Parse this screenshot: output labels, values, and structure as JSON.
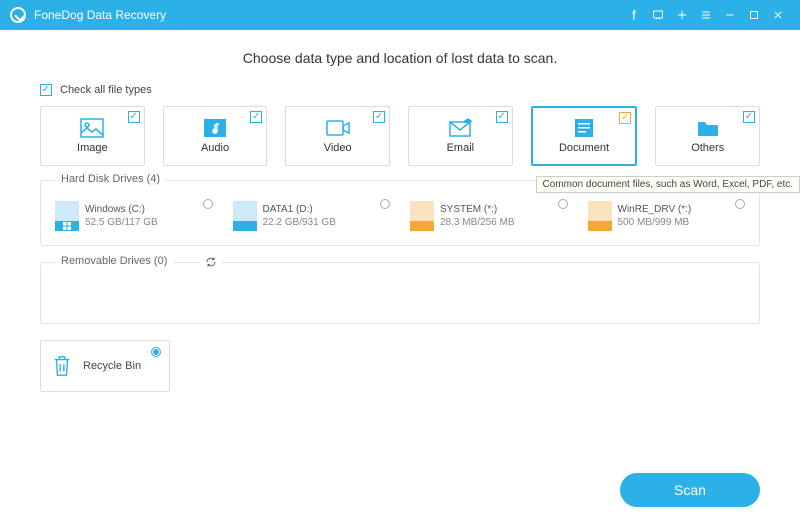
{
  "app": {
    "title": "FoneDog Data Recovery"
  },
  "heading": "Choose data type and location of lost data to scan.",
  "checkAll": {
    "label": "Check all file types",
    "checked": true
  },
  "types": [
    {
      "id": "image",
      "label": "Image",
      "checked": true,
      "selected": false
    },
    {
      "id": "audio",
      "label": "Audio",
      "checked": true,
      "selected": false
    },
    {
      "id": "video",
      "label": "Video",
      "checked": true,
      "selected": false
    },
    {
      "id": "email",
      "label": "Email",
      "checked": true,
      "selected": false
    },
    {
      "id": "document",
      "label": "Document",
      "checked": true,
      "selected": true
    },
    {
      "id": "others",
      "label": "Others",
      "checked": true,
      "selected": false
    }
  ],
  "tooltip": "Common document files, such as Word, Excel, PDF, etc.",
  "groups": {
    "hdd": {
      "title": "Hard Disk Drives (4)"
    },
    "removable": {
      "title": "Removable Drives (0)"
    }
  },
  "drives": [
    {
      "name": "Windows (C:)",
      "size": "52.5 GB/117 GB",
      "color": "blue",
      "windows": true
    },
    {
      "name": "DATA1 (D:)",
      "size": "22.2 GB/931 GB",
      "color": "blue",
      "windows": false
    },
    {
      "name": "SYSTEM (*:)",
      "size": "28.3 MB/256 MB",
      "color": "orange",
      "windows": false
    },
    {
      "name": "WinRE_DRV (*:)",
      "size": "500 MB/999 MB",
      "color": "orange",
      "windows": false
    }
  ],
  "recycle": {
    "label": "Recycle Bin",
    "selected": true
  },
  "scanButton": "Scan",
  "colors": {
    "primary": "#2bb1e8",
    "accent": "#f7a833"
  }
}
